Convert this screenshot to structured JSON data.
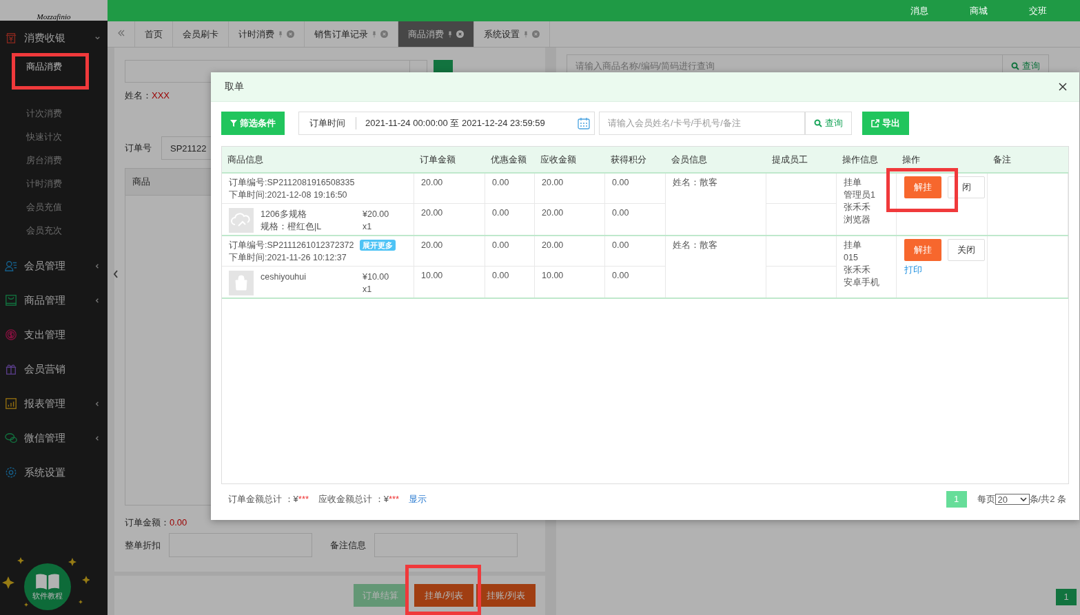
{
  "sidebar": {
    "logo": "Mozzafinio",
    "groups": [
      {
        "label": "消费收银",
        "has_children": true,
        "expanded": true,
        "children": [
          {
            "label": "商品消费",
            "selected": true
          },
          {
            "label": "计次消费",
            "selected": false
          },
          {
            "label": "快速计次",
            "selected": false
          },
          {
            "label": "房台消费",
            "selected": false
          },
          {
            "label": "计时消费",
            "selected": false
          },
          {
            "label": "会员充值",
            "selected": false
          },
          {
            "label": "会员充次",
            "selected": false
          }
        ]
      },
      {
        "label": "会员管理",
        "has_children": true,
        "expanded": false
      },
      {
        "label": "商品管理",
        "has_children": true,
        "expanded": false
      },
      {
        "label": "支出管理",
        "has_children": false
      },
      {
        "label": "会员营销",
        "has_children": false
      },
      {
        "label": "报表管理",
        "has_children": true,
        "expanded": false
      },
      {
        "label": "微信管理",
        "has_children": true,
        "expanded": false
      },
      {
        "label": "系统设置",
        "has_children": false
      }
    ],
    "help_badge": "软件教程"
  },
  "topbar": {
    "links": [
      "消息",
      "商城",
      "交班"
    ]
  },
  "tabs": [
    {
      "label": "首页",
      "selected": false,
      "closable": false
    },
    {
      "label": "会员刷卡",
      "selected": false,
      "closable": false
    },
    {
      "label": "计时消费",
      "selected": false,
      "closable": true
    },
    {
      "label": "销售订单记录",
      "selected": false,
      "closable": true
    },
    {
      "label": "商品消费",
      "selected": true,
      "closable": true
    },
    {
      "label": "系统设置",
      "selected": false,
      "closable": true
    }
  ],
  "left_panel": {
    "name_label": "姓名：",
    "name_value": "XXX",
    "order_no_label": "订单号",
    "order_no_value": "SP21122",
    "table_header": "商品",
    "summary": [
      {
        "label": "订单金额：",
        "value": "0.00"
      }
    ],
    "discount_label": "整单折扣",
    "remark_label": "备注信息",
    "buttons": [
      {
        "label": "订单结算",
        "disabled": true
      },
      {
        "label": "挂单/列表",
        "disabled": false
      },
      {
        "label": "挂账/列表",
        "disabled": false
      }
    ]
  },
  "right_panel": {
    "search_placeholder": "请输入商品名称/编码/简码进行查询",
    "search_button": "查询",
    "page": "1"
  },
  "modal": {
    "title": "取单",
    "filter_button": "筛选条件",
    "date_label": "订单时间",
    "date_value": "2021-11-24 00:00:00 至 2021-12-24 23:59:59",
    "search_placeholder": "请输入会员姓名/卡号/手机号/备注",
    "search_button": "查询",
    "export_button": "导出",
    "columns": [
      "商品信息",
      "订单金额",
      "优惠金额",
      "应收金额",
      "获得积分",
      "会员信息",
      "提成员工",
      "操作信息",
      "操作",
      "备注"
    ],
    "orders": [
      {
        "order_no": "订单编号:SP2112081916508335",
        "order_time": "下单时间:2021-12-08 19:16:50",
        "order_amount": "20.00",
        "discount": "0.00",
        "receivable": "20.00",
        "points": "0.00",
        "member": "姓名：散客",
        "op_info": [
          "挂单",
          "管理员1",
          "张禾禾",
          "浏览器"
        ],
        "resume_button": "解挂",
        "close_button": "闭",
        "product": {
          "name": "1206多规格",
          "spec": "规格：橙红色|L",
          "price": "¥20.00",
          "qty": "x1",
          "amount": "20.00",
          "discount": "0.00",
          "receivable": "20.00",
          "points": "0.00"
        }
      },
      {
        "order_no": "订单编号:SP2111261012372372",
        "badge": "展开更多",
        "order_time": "下单时间:2021-11-26 10:12:37",
        "order_amount": "20.00",
        "discount": "0.00",
        "receivable": "20.00",
        "points": "0.00",
        "member": "姓名：散客",
        "op_info": [
          "挂单",
          "015",
          "张禾禾",
          "安卓手机"
        ],
        "resume_button": "解挂",
        "close_button": "关闭",
        "print_link": "打印",
        "product": {
          "name": "ceshiyouhui",
          "price": "¥10.00",
          "qty": "x1",
          "amount": "10.00",
          "discount": "0.00",
          "receivable": "10.00",
          "points": "0.00"
        }
      }
    ],
    "totals": [
      {
        "label": "订单金额总计 ：¥",
        "value": "***"
      },
      {
        "label": "应收金额总计 ：¥",
        "value": "***"
      }
    ],
    "show_link": "显示",
    "page": "1",
    "per_page_label": "每页",
    "per_page": "20",
    "total": "条/共2 条"
  }
}
